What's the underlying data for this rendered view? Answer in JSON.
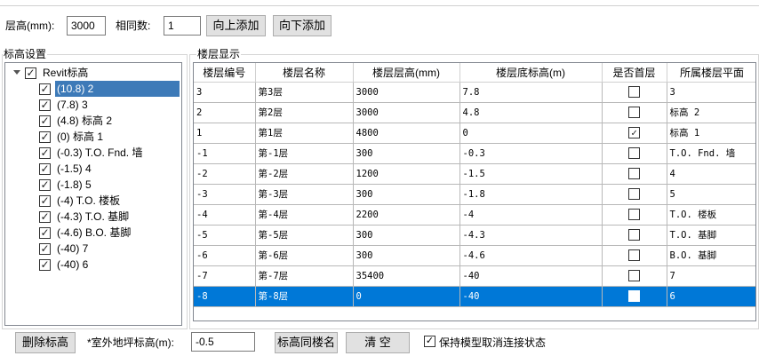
{
  "toolbar": {
    "floor_height_label": "层高(mm):",
    "floor_height_value": "3000",
    "same_count_label": "相同数:",
    "same_count_value": "1",
    "add_up_label": "向上添加",
    "add_down_label": "向下添加"
  },
  "level_settings": {
    "title": "标高设置",
    "root": {
      "label": "Revit标高",
      "checked": true
    },
    "items": [
      {
        "label": "(10.8) 2",
        "checked": true,
        "selected": true
      },
      {
        "label": "(7.8) 3",
        "checked": true
      },
      {
        "label": "(4.8) 标高 2",
        "checked": true
      },
      {
        "label": "(0) 标高 1",
        "checked": true
      },
      {
        "label": "(-0.3) T.O. Fnd. 墙",
        "checked": true
      },
      {
        "label": "(-1.5) 4",
        "checked": true
      },
      {
        "label": "(-1.8) 5",
        "checked": true
      },
      {
        "label": "(-4) T.O. 楼板",
        "checked": true
      },
      {
        "label": "(-4.3) T.O. 基脚",
        "checked": true
      },
      {
        "label": "(-4.6) B.O. 基脚",
        "checked": true
      },
      {
        "label": "(-40) 7",
        "checked": true
      },
      {
        "label": "(-40) 6",
        "checked": true
      }
    ]
  },
  "floor_display": {
    "title": "楼层显示",
    "columns": [
      "楼层编号",
      "楼层名称",
      "楼层层高(mm)",
      "楼层底标高(m)",
      "是否首层",
      "所属楼层平面"
    ],
    "rows": [
      {
        "num": "3",
        "name": "第3层",
        "height": "3000",
        "bottom": "7.8",
        "first": false,
        "plane": "3"
      },
      {
        "num": "2",
        "name": "第2层",
        "height": "3000",
        "bottom": "4.8",
        "first": false,
        "plane": "标高 2"
      },
      {
        "num": "1",
        "name": "第1层",
        "height": "4800",
        "bottom": "0",
        "first": true,
        "plane": "标高 1"
      },
      {
        "num": "-1",
        "name": "第-1层",
        "height": "300",
        "bottom": "-0.3",
        "first": false,
        "plane": "T.O. Fnd. 墙"
      },
      {
        "num": "-2",
        "name": "第-2层",
        "height": "1200",
        "bottom": "-1.5",
        "first": false,
        "plane": "4"
      },
      {
        "num": "-3",
        "name": "第-3层",
        "height": "300",
        "bottom": "-1.8",
        "first": false,
        "plane": "5"
      },
      {
        "num": "-4",
        "name": "第-4层",
        "height": "2200",
        "bottom": "-4",
        "first": false,
        "plane": "T.O. 楼板"
      },
      {
        "num": "-5",
        "name": "第-5层",
        "height": "300",
        "bottom": "-4.3",
        "first": false,
        "plane": "T.O. 基脚"
      },
      {
        "num": "-6",
        "name": "第-6层",
        "height": "300",
        "bottom": "-4.6",
        "first": false,
        "plane": "B.O. 基脚"
      },
      {
        "num": "-7",
        "name": "第-7层",
        "height": "35400",
        "bottom": "-40",
        "first": false,
        "plane": "7"
      },
      {
        "num": "-8",
        "name": "第-8层",
        "height": "0",
        "bottom": "-40",
        "first": false,
        "plane": "6",
        "selected": true
      }
    ]
  },
  "footer": {
    "delete_level_label": "删除标高",
    "outdoor_label": "*室外地坪标高(m):",
    "outdoor_value": "-0.5",
    "same_name_label": "标高同楼名",
    "clear_label": "清  空",
    "keep_model_label": "保持模型取消连接状态",
    "keep_model_checked": true,
    "check_mark": "✓"
  }
}
